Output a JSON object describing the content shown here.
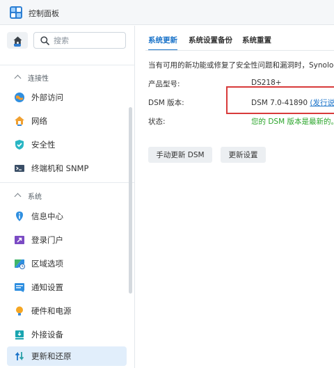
{
  "window": {
    "title": "控制面板"
  },
  "search": {
    "placeholder": "搜索"
  },
  "sidebar": {
    "sections": [
      {
        "label": "连接性"
      },
      {
        "label": "系统"
      }
    ],
    "items": [
      {
        "label": "外部访问",
        "icon": "globe-icon"
      },
      {
        "label": "网络",
        "icon": "house-network-icon"
      },
      {
        "label": "安全性",
        "icon": "shield-check-icon"
      },
      {
        "label": "终端机和 SNMP",
        "icon": "terminal-icon"
      },
      {
        "label": "信息中心",
        "icon": "info-icon"
      },
      {
        "label": "登录门户",
        "icon": "login-portal-icon"
      },
      {
        "label": "区域选项",
        "icon": "region-clock-icon"
      },
      {
        "label": "通知设置",
        "icon": "notification-icon"
      },
      {
        "label": "硬件和电源",
        "icon": "lightbulb-icon"
      },
      {
        "label": "外接设备",
        "icon": "external-device-icon"
      },
      {
        "label": "更新和还原",
        "icon": "update-restore-icon",
        "active": true
      }
    ]
  },
  "main": {
    "tabs": [
      {
        "label": "系统更新",
        "active": true
      },
      {
        "label": "系统设置备份"
      },
      {
        "label": "系统重置"
      }
    ],
    "notice": "当有可用的新功能或修复了安全性问题和漏洞时，Synolog",
    "rows": [
      {
        "label": "产品型号:",
        "value": "DS218+"
      },
      {
        "label": "DSM 版本:",
        "value": "DSM 7.0-41890 ",
        "link": "(发行说明"
      },
      {
        "label": "状态:",
        "value": "您的 DSM 版本是最新的。"
      }
    ],
    "buttons": {
      "manual_update": "手动更新 DSM",
      "update_settings": "更新设置"
    }
  },
  "colors": {
    "accent": "#1a73c9",
    "status_ok": "#2aa52a",
    "highlight": "#d83a3a",
    "active_item_bg": "#e1eefb"
  }
}
